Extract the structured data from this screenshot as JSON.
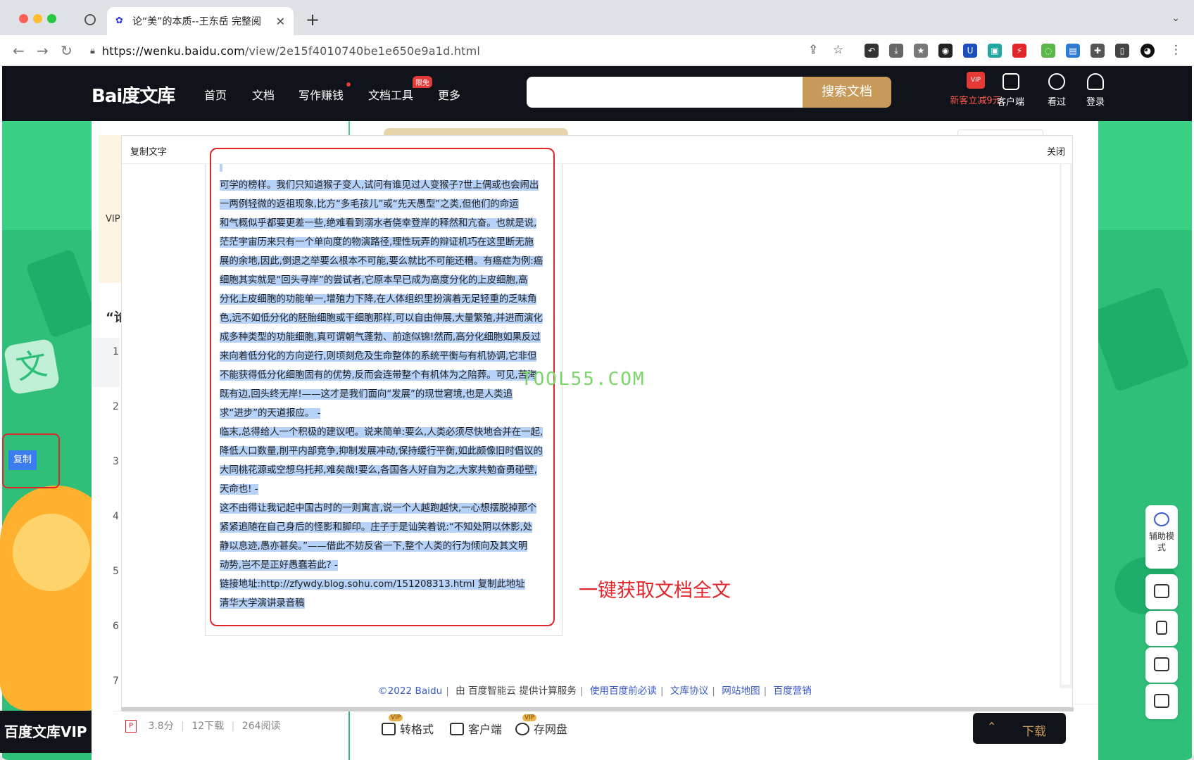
{
  "browser": {
    "tab_title": "论“美”的本质--王东岳 完整阅",
    "url_domain": "https://wenku.baidu.com",
    "url_path": "/view/2e15f4010740be1e650e9a1d.html"
  },
  "site": {
    "logo_text": "Bai度文库",
    "nav": [
      "首页",
      "文档",
      "写作赚钱",
      "文档工具",
      "更多"
    ],
    "tools_badge": "限免",
    "search_button": "搜索文档",
    "header_items": {
      "vip_promo": "新客立减9元",
      "vip_icon": "VIP",
      "client": "客户端",
      "history": "看过",
      "login": "登录"
    }
  },
  "doc": {
    "vip_label": "VIP",
    "title_fragment": "“论",
    "row_numbers": [
      "1",
      "2",
      "3",
      "4",
      "5",
      "6",
      "7"
    ],
    "side_copy_button": "复制",
    "vip_band": "百度文库VIP",
    "meta": {
      "score": "3.8分",
      "downloads": "12下载",
      "reads": "264阅读"
    },
    "bottom_bar": {
      "convert": "转格式",
      "client": "客户端",
      "save": "存网盘",
      "vip_tag": "VIP",
      "download": "下载"
    },
    "float_tools": {
      "assist": "辅助模式"
    }
  },
  "modal": {
    "title": "复制文字",
    "close": "关闭",
    "lines": [
      "可学的榜样。我们只知道猴子变人,试问有谁见过人变猴子?世上偶或也会闹出",
      "一两例轻微的返祖现象,比方“多毛孩儿”或“先天愚型”之类,但他们的命运",
      "和气概似乎都要更差一些,绝难看到溺水者侥幸登岸的释然和亢奋。也就是说,",
      "茫茫宇宙历来只有一个单向度的物演路径,理性玩弄的辩证机巧在这里断无施",
      "展的余地,因此,倒退之举要么根本不可能,要么就比不可能还糟。有癌症为例:癌",
      "细胞其实就是“回头寻岸”的尝试者,它原本早已成为高度分化的上皮细胞,高",
      "分化上皮细胞的功能单一,增殖力下降,在人体组织里扮演着无足轻重的乏味角",
      "色,远不如低分化的胚胎细胞或干细胞那样,可以自由伸展,大量繁殖,并进而演化",
      "成多种类型的功能细胞,真可谓朝气蓬勃、前途似锦!然而,高分化细胞如果反过",
      "来向着低分化的方向逆行,则顷刻危及生命整体的系统平衡与有机协调,它非但",
      "不能获得低分化细胞固有的优势,反而会连带整个有机体为之陪葬。可见,苦海",
      "既有边,回头终无岸!——这才是我们面向“发展”的现世窘境,也是人类追",
      "求“进步”的天道报应。 -",
      "临末,总得给人一个积极的建议吧。说来简单:要么,人类必须尽快地合并在一起,",
      "降低人口数量,削平内部竞争,抑制发展冲动,保持缓行平衡,如此颇像旧时倡议的",
      "大同桃花源或空想乌托邦,难矣哉!要么,各国各人好自为之,大家共勉奋勇碰壁,",
      "天命也! -",
      " 这不由得让我记起中国古时的一则寓言,说一个人越跑越快,一心想摆脱掉那个",
      "紧紧追随在自己身后的怪影和脚印。庄子于是讪笑着说:“不知处阴以休影,处",
      "静以息迹,愚亦甚矣。”——借此不妨反省一下,整个人类的行为倾向及其文明",
      "动势,岂不是正好愚蠢若此? -",
      "链接地址:http://zfywdy.blog.sohu.com/151208313.html 复制此地址",
      "清华大学演讲录音稿"
    ]
  },
  "overlay": {
    "watermark": "TOOL55.COM",
    "annotation": "一键获取文档全文"
  },
  "footer": {
    "copyright": "©2022 Baidu",
    "service": "由 百度智能云 提供计算服务",
    "links": [
      "使用百度前必读",
      "文库协议",
      "网站地图",
      "百度营销"
    ]
  },
  "colors": {
    "brand_dark": "#101319",
    "gold": "#c79a5a",
    "green": "#2fbf79",
    "highlight": "#b6d2f8",
    "annotation_red": "#e0262b"
  }
}
